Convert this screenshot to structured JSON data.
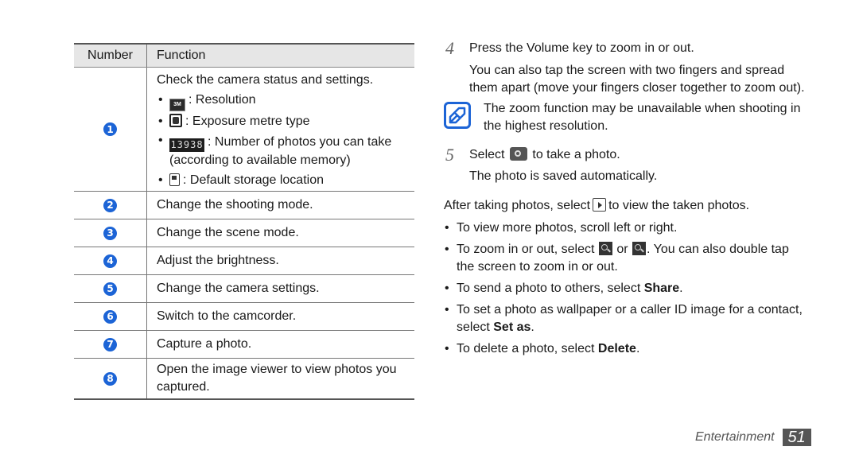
{
  "table": {
    "headers": [
      "Number",
      "Function"
    ],
    "rows": [
      {
        "number": "1",
        "intro": "Check the camera status and settings.",
        "items": [
          {
            "icon": "resolution-icon",
            "icon_text": "3M",
            "text": ": Resolution"
          },
          {
            "icon": "exposure-metre-icon",
            "text": ": Exposure metre type"
          },
          {
            "icon": "photo-count-icon",
            "icon_text": "13938",
            "text": ": Number of photos you can take (according to available memory)"
          },
          {
            "icon": "storage-icon",
            "text": ": Default storage location"
          }
        ]
      },
      {
        "number": "2",
        "text": "Change the shooting mode."
      },
      {
        "number": "3",
        "text": "Change the scene mode."
      },
      {
        "number": "4",
        "text": "Adjust the brightness."
      },
      {
        "number": "5",
        "text": "Change the camera settings."
      },
      {
        "number": "6",
        "text": "Switch to the camcorder."
      },
      {
        "number": "7",
        "text": "Capture a photo."
      },
      {
        "number": "8",
        "text": "Open the image viewer to view photos you captured."
      }
    ]
  },
  "steps": [
    {
      "number": "4",
      "text": "Press the Volume key to zoom in or out.",
      "detail": "You can also tap the screen with two fingers and spread them apart (move your fingers closer together to zoom out).",
      "note": "The zoom function may be unavailable when shooting in the highest resolution."
    },
    {
      "number": "5",
      "text_before": "Select",
      "text_after": "to take a photo.",
      "detail": "The photo is saved automatically."
    }
  ],
  "after": {
    "before": "After taking photos, select",
    "after": "to view the taken photos."
  },
  "bullets": [
    {
      "text": "To view more photos, scroll left or right."
    },
    {
      "pre": "To zoom in or out, select",
      "mid": "or",
      "post": ". You can also double tap the screen to zoom in or out."
    },
    {
      "pre": "To send a photo to others, select ",
      "bold": "Share",
      "post": "."
    },
    {
      "pre": "To set a photo as wallpaper or a caller ID image for a contact, select ",
      "bold": "Set as",
      "post": "."
    },
    {
      "pre": "To delete a photo, select ",
      "bold": "Delete",
      "post": "."
    }
  ],
  "footer": {
    "section": "Entertainment",
    "page": "51"
  },
  "colors": {
    "accent": "#1c64d6",
    "header_bg": "#e6e6e6",
    "page_badge": "#555555"
  }
}
